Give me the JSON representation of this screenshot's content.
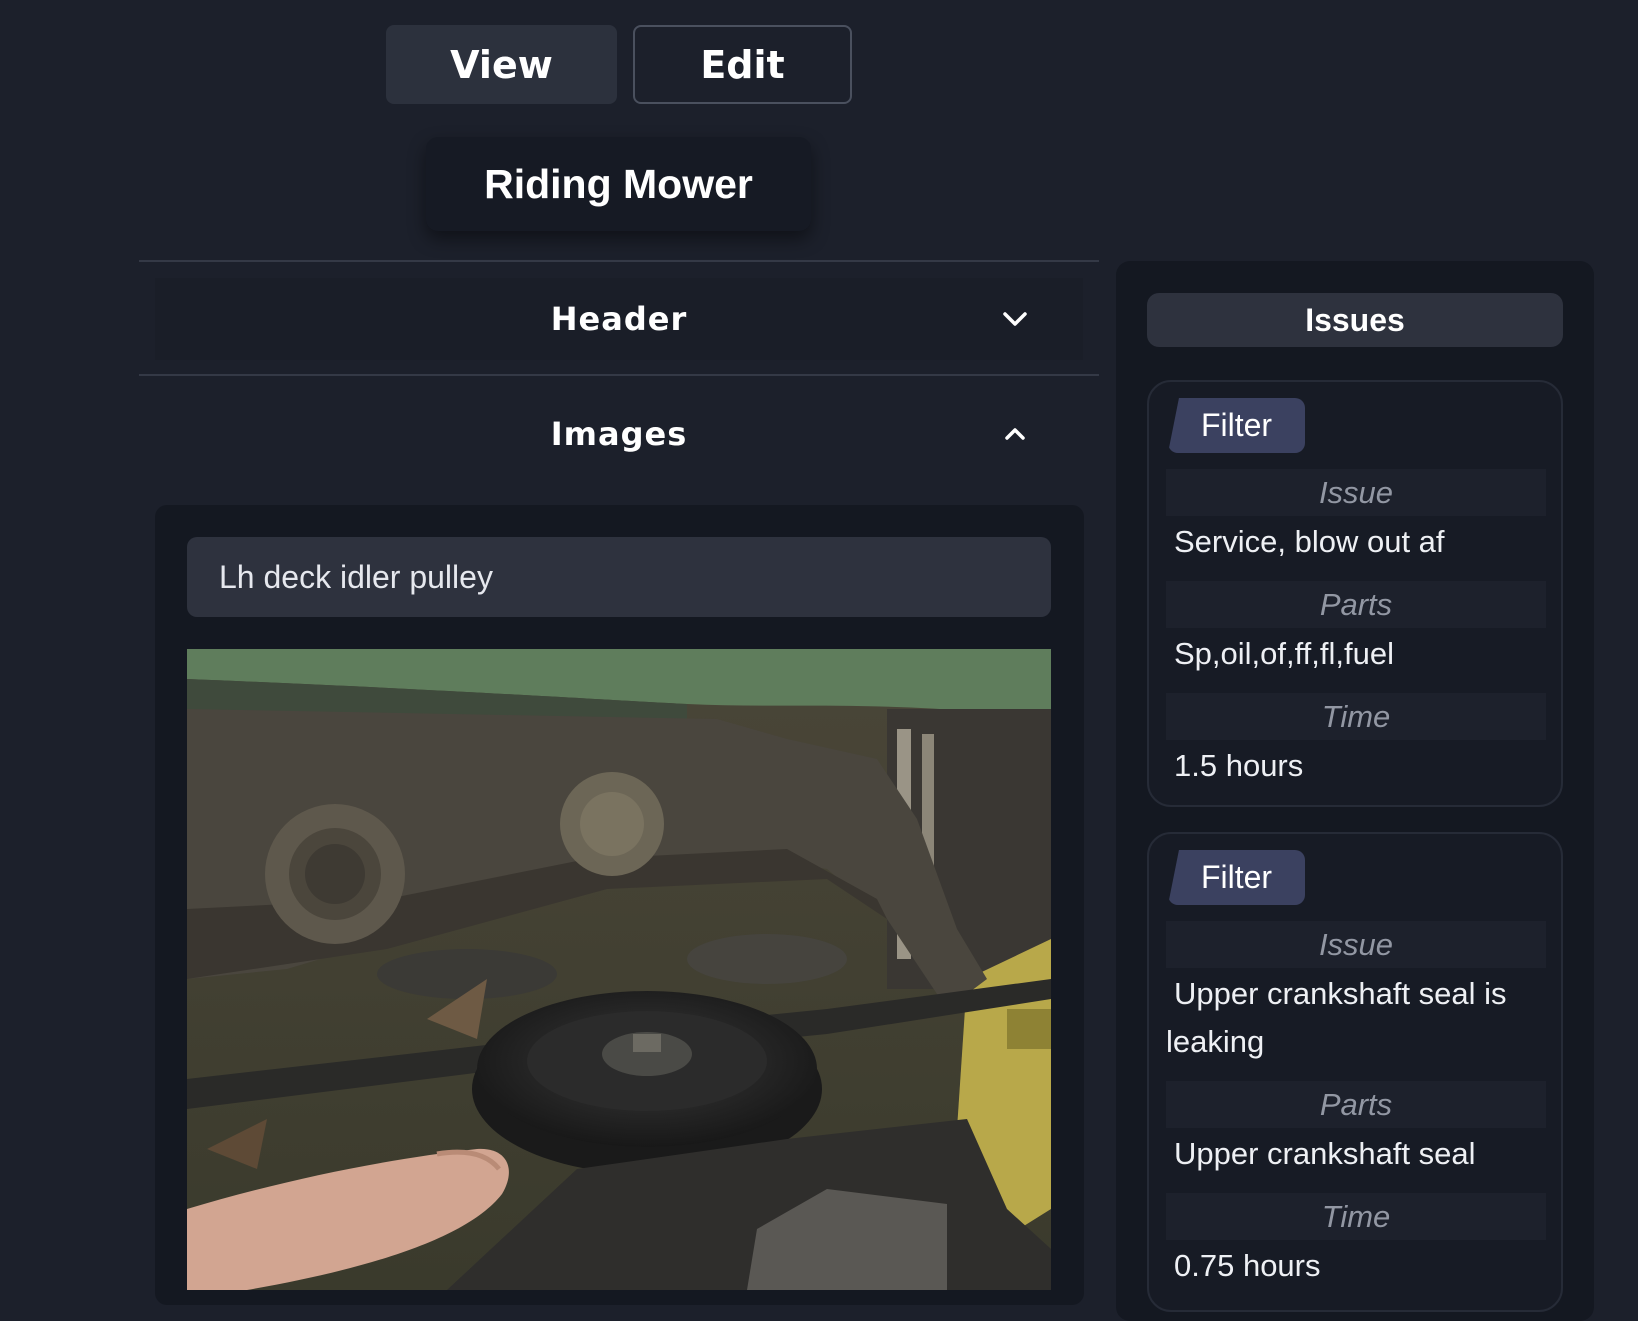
{
  "toolbar": {
    "view_label": "View",
    "edit_label": "Edit"
  },
  "page_title": "Riding Mower",
  "sections": {
    "header_label": "Header",
    "images_label": "Images"
  },
  "images": {
    "caption_value": "Lh deck idler pulley"
  },
  "issues": {
    "title": "Issues",
    "cards": [
      {
        "tag": "Filter",
        "issue_label": "Issue",
        "issue": "Service, blow out af",
        "parts_label": "Parts",
        "parts": "Sp,oil,of,ff,fl,fuel",
        "time_label": "Time",
        "time": "1.5 hours"
      },
      {
        "tag": "Filter",
        "issue_label": "Issue",
        "issue": "Upper crankshaft seal is leaking",
        "parts_label": "Parts",
        "parts": "Upper crankshaft seal",
        "time_label": "Time",
        "time": "0.75 hours"
      }
    ]
  },
  "icons": {
    "collapse": "chevron-down-icon",
    "expand": "chevron-up-icon"
  },
  "colors": {
    "background": "#1c202b",
    "panel": "#141821",
    "tag": "#3b4160"
  }
}
